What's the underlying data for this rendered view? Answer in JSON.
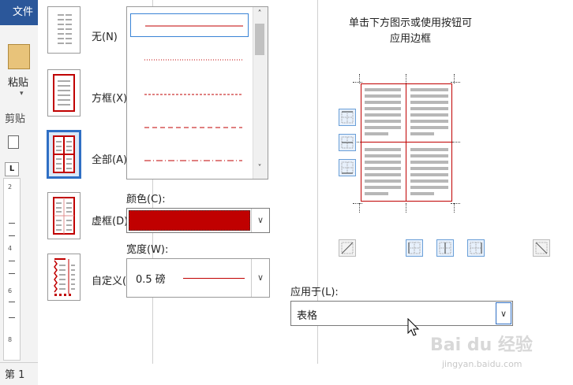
{
  "word": {
    "file_tab": "文件",
    "paste_label": "粘贴",
    "clipboard_label": "剪贴",
    "ruler_corner": "L",
    "ruler_numbers": [
      "2",
      "4",
      "6",
      "8"
    ],
    "status_page": "第 1"
  },
  "dialog": {
    "settings": [
      {
        "label": "无(N)"
      },
      {
        "label": "方框(X)"
      },
      {
        "label": "全部(A)"
      },
      {
        "label": "虚框(D)"
      },
      {
        "label": "自定义(U)"
      }
    ],
    "selected_setting": "全部(A)",
    "style_list": {
      "styles": [
        "solid",
        "dotted",
        "dashed-small",
        "dashed",
        "dash-dot"
      ],
      "selected_index": 0,
      "scroll_up": "˄",
      "scroll_down": "˅"
    },
    "color": {
      "label": "颜色(C):",
      "value_hex": "#c00000",
      "dropdown": "∨"
    },
    "width": {
      "label": "宽度(W):",
      "value": "0.5 磅",
      "dropdown": "∨"
    },
    "preview": {
      "hint_line1": "单击下方图示或使用按钮可",
      "hint_line2": "应用边框",
      "border_color": "#c00000"
    },
    "apply_to": {
      "label": "应用于(L):",
      "value": "表格",
      "dropdown": "∨"
    }
  },
  "watermark": {
    "text": "Bai du 经验",
    "url": "jingyan.baidu.com"
  },
  "colors": {
    "accent": "#2f6fc4",
    "border_red": "#c00000",
    "word_blue": "#2b579a"
  }
}
